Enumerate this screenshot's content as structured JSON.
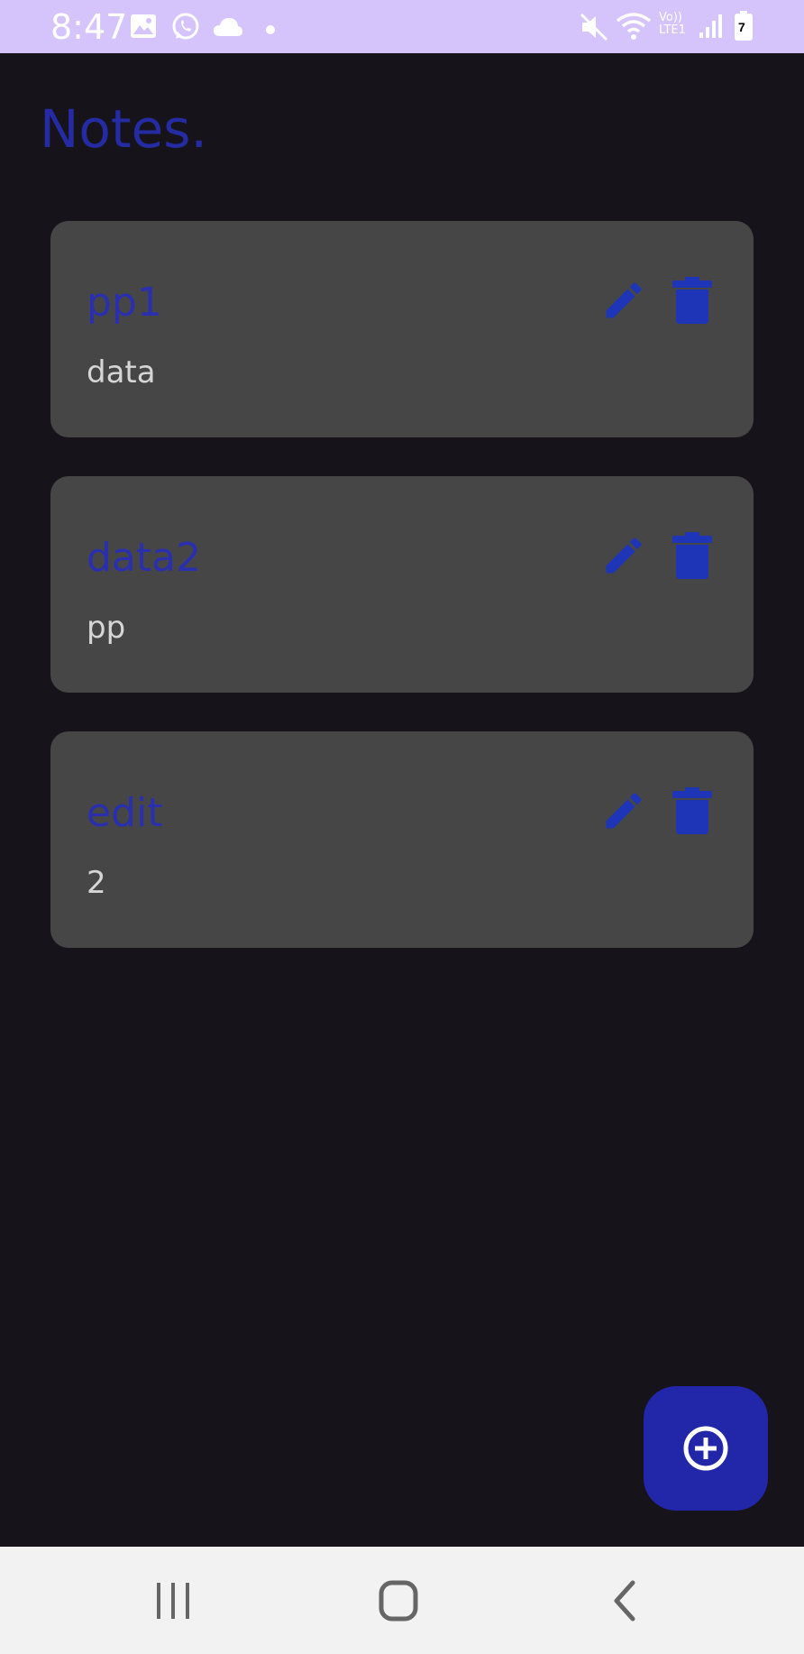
{
  "status_bar": {
    "time": "8:47",
    "network_label": "Vo)) LTE1",
    "battery_level": "7",
    "icons": [
      "gallery-icon",
      "whatsapp-icon",
      "cloud-icon",
      "dot-icon",
      "mute-icon",
      "wifi-icon",
      "signal-icon",
      "battery-icon"
    ]
  },
  "app": {
    "title": "Notes.",
    "notes": [
      {
        "title": "pp1",
        "body": "data"
      },
      {
        "title": "data2",
        "body": "pp"
      },
      {
        "title": "edit",
        "body": "2"
      }
    ],
    "actions": {
      "edit_icon": "pencil-icon",
      "delete_icon": "trash-icon",
      "add_icon": "add-circle-icon"
    },
    "colors": {
      "background": "#16141a",
      "card": "#464646",
      "accent": "#2226a8",
      "title": "#242ba3",
      "status_bar": "#d4c4fb"
    }
  },
  "nav_bar": {
    "buttons": [
      "recents-icon",
      "home-icon",
      "back-icon"
    ]
  }
}
